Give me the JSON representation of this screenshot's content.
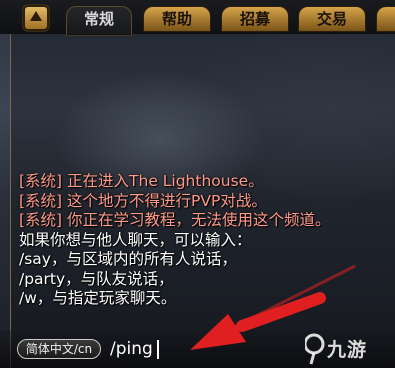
{
  "tabs": [
    {
      "label": "常规",
      "active": true
    },
    {
      "label": "帮助"
    },
    {
      "label": "招募"
    },
    {
      "label": "交易"
    },
    {
      "label": ""
    }
  ],
  "messages": [
    {
      "text": "[系统] 正在进入The Lighthouse。",
      "type": "system"
    },
    {
      "text": "[系统] 这个地方不得进行PVP对战。",
      "type": "system"
    },
    {
      "text": "[系统] 你正在学习教程，无法使用这个频道。",
      "type": "system"
    },
    {
      "text": "如果你想与他人聊天，可以输入：",
      "type": "normal"
    },
    {
      "text": " /say，与区域内的所有人说话，",
      "type": "normal"
    },
    {
      "text": "/party，与队友说话，",
      "type": "normal"
    },
    {
      "text": "/w，与指定玩家聊天。",
      "type": "normal"
    }
  ],
  "input": {
    "language_button": "简体中文/cn",
    "value": "/ping"
  },
  "watermark": {
    "text": "九游"
  },
  "colors": {
    "system_text": "#ff9a8a",
    "normal_text": "#ffffff",
    "tab_gold": "#d6a44a",
    "arrow_red": "#e02020"
  },
  "icons": {
    "menu": "up-triangle-icon",
    "watermark": "jiuyou-logo-icon"
  }
}
